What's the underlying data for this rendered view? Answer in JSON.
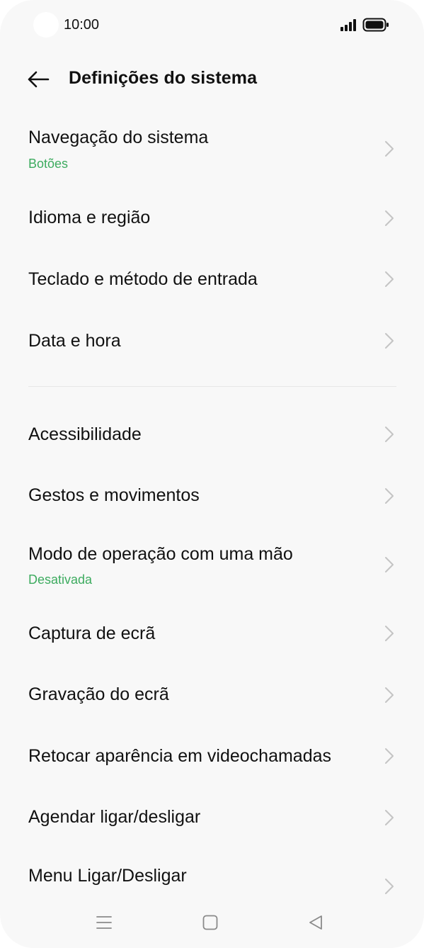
{
  "status_bar": {
    "time": "10:00",
    "icons": [
      "signal-icon",
      "battery-icon"
    ]
  },
  "header": {
    "title": "Definições do sistema",
    "back_icon": "arrow-left-icon"
  },
  "items": [
    {
      "label": "Navegação do sistema",
      "sub": "Botões"
    },
    {
      "label": "Idioma e região"
    },
    {
      "label": "Teclado e método de entrada"
    },
    {
      "label": "Data e hora"
    },
    {
      "label": "Acessibilidade"
    },
    {
      "label": "Gestos e movimentos"
    },
    {
      "label": "Modo de operação com uma mão",
      "sub": "Desativada"
    },
    {
      "label": "Captura de ecrã"
    },
    {
      "label": "Gravação do ecrã"
    },
    {
      "label": "Retocar aparência em videochamadas"
    },
    {
      "label": "Agendar ligar/desligar"
    },
    {
      "label": "Menu Ligar/Desligar"
    }
  ],
  "nav_bar": {
    "icons": [
      "menu-icon",
      "home-icon",
      "back-triangle-icon"
    ]
  },
  "colors": {
    "accent": "#3dab5f",
    "background": "#f8f8f8",
    "chevron": "#c4c4c4"
  }
}
